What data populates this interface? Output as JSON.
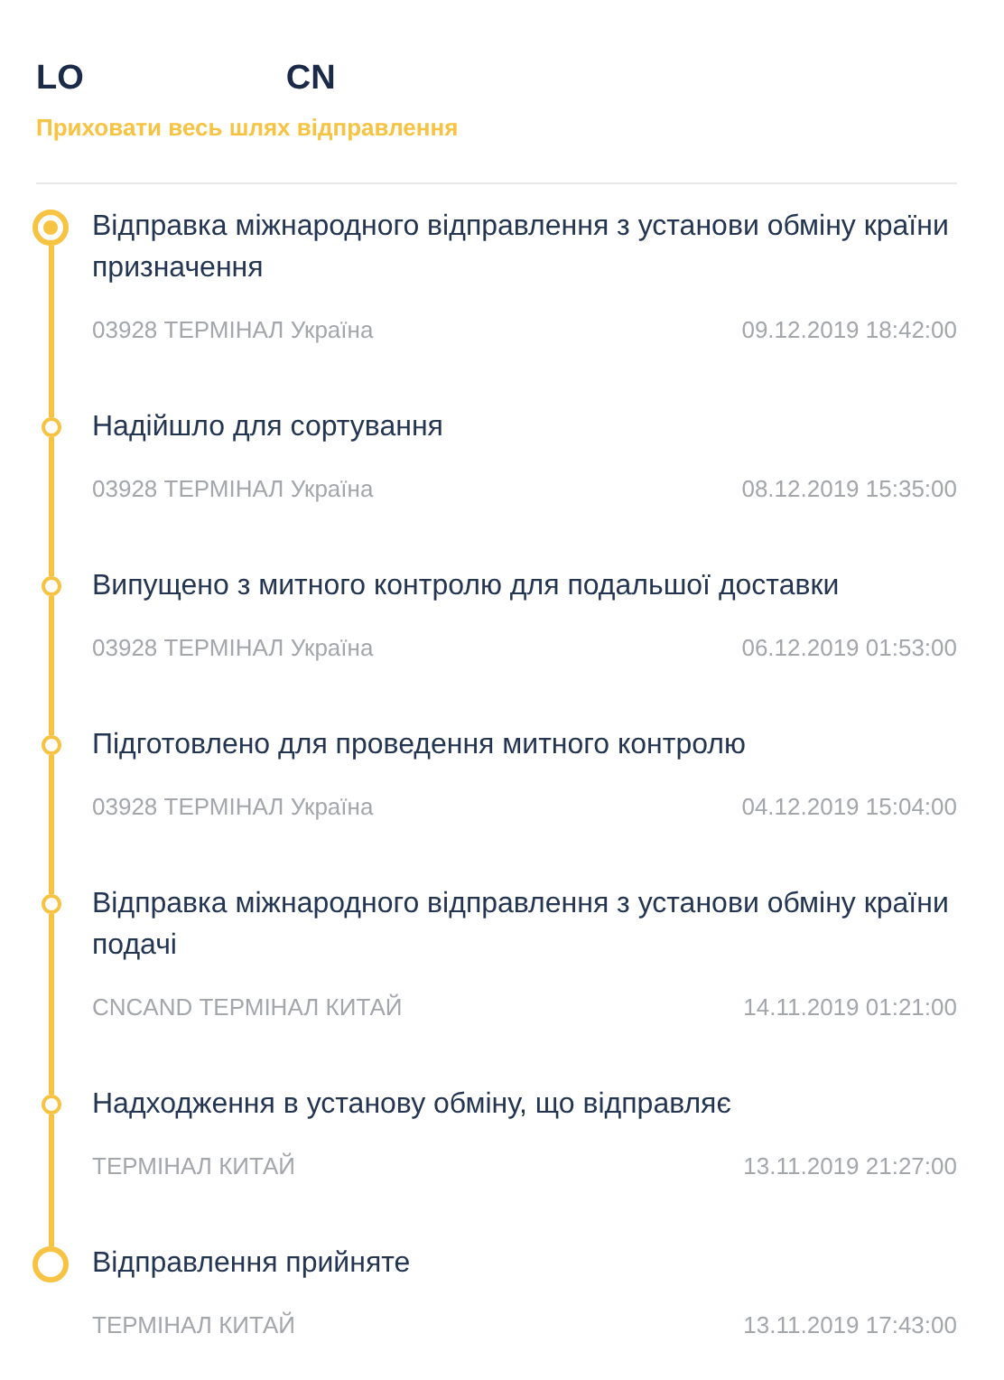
{
  "header": {
    "tracking_number_start": "LO",
    "tracking_number_end": "CN",
    "toggle_link": "Приховати весь шлях відправлення"
  },
  "events": [
    {
      "kind": "current",
      "title": "Відправка міжнародного відправлення з установи обміну країни призначення",
      "location": "03928 ТЕРМІНАЛ Україна",
      "datetime": "09.12.2019 18:42:00"
    },
    {
      "kind": "step",
      "title": "Надійшло для сортування",
      "location": "03928 ТЕРМІНАЛ Україна",
      "datetime": "08.12.2019 15:35:00"
    },
    {
      "kind": "step",
      "title": "Випущено з митного контролю для подальшої доставки",
      "location": "03928 ТЕРМІНАЛ Україна",
      "datetime": "06.12.2019 01:53:00"
    },
    {
      "kind": "step",
      "title": "Підготовлено для проведення митного контролю",
      "location": "03928 ТЕРМІНАЛ Україна",
      "datetime": "04.12.2019 15:04:00"
    },
    {
      "kind": "step",
      "title": "Відправка міжнародного відправлення з установи обміну країни подачі",
      "location": "CNCAND ТЕРМІНАЛ КИТАЙ",
      "datetime": "14.11.2019 01:21:00"
    },
    {
      "kind": "step",
      "title": "Надходження в установу обміну, що відправляє",
      "location": "ТЕРМІНАЛ КИТАЙ",
      "datetime": "13.11.2019 21:27:00"
    },
    {
      "kind": "origin",
      "title": "Відправлення прийняте",
      "location": "ТЕРМІНАЛ КИТАЙ",
      "datetime": "13.11.2019 17:43:00"
    }
  ]
}
